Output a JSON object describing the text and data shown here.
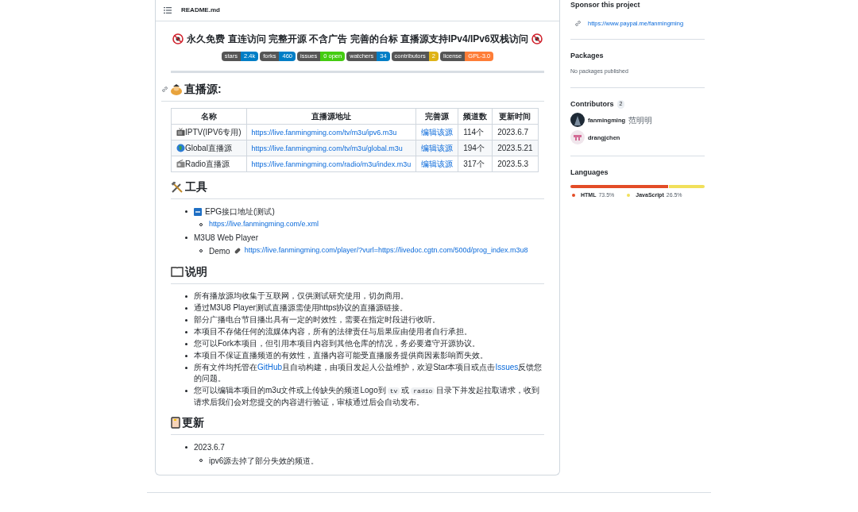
{
  "readme": {
    "file_name": "README.md",
    "tagline": "永久免费 直连访问 完整开源 不含广告 完善的台标 直播源支持IPv4/IPv6双栈访问",
    "badges": [
      {
        "label": "stars",
        "value": "2.4k",
        "color": "#007ec6"
      },
      {
        "label": "forks",
        "value": "460",
        "color": "#007ec6"
      },
      {
        "label": "issues",
        "value": "0 open",
        "color": "#4c1"
      },
      {
        "label": "watchers",
        "value": "34",
        "color": "#007ec6"
      },
      {
        "label": "contributors",
        "value": "2",
        "color": "#dfb317"
      },
      {
        "label": "license",
        "value": "GPL-3.0",
        "color": "#fe7d37"
      }
    ],
    "sources": {
      "heading": "直播源:",
      "columns": [
        "名称",
        "直播源地址",
        "完善源",
        "频道数",
        "更新时间"
      ],
      "rows": [
        {
          "name": "IPTV(IPV6专用)",
          "url": "https://live.fanmingming.com/tv/m3u/ipv6.m3u",
          "edit": "编辑该源",
          "count": "114个",
          "updated": "2023.6.7"
        },
        {
          "name": "Global直播源",
          "url": "https://live.fanmingming.com/tv/m3u/global.m3u",
          "edit": "编辑该源",
          "count": "194个",
          "updated": "2023.5.21"
        },
        {
          "name": "Radio直播源",
          "url": "https://live.fanmingming.com/radio/m3u/index.m3u",
          "edit": "编辑该源",
          "count": "317个",
          "updated": "2023.5.3"
        }
      ]
    },
    "tools": {
      "heading": "工具",
      "items": [
        {
          "text": "EPG接口地址(测试)",
          "sub_link": "https://live.fanmingming.com/e.xml"
        },
        {
          "text": "M3U8 Web Player",
          "sub_prefix": "Demo",
          "sub_link": "https://live.fanmingming.com/player/?vurl=https://livedoc.cgtn.com/500d/prog_index.m3u8"
        }
      ]
    },
    "notes": {
      "heading": "说明",
      "items": [
        [
          {
            "kind": "text",
            "text": "所有播放源均收集于互联网，仅供测试研究使用，切勿商用。"
          }
        ],
        [
          {
            "kind": "text",
            "text": "通过M3U8 Player测试直播源需使用https协议的直播源链接。"
          }
        ],
        [
          {
            "kind": "text",
            "text": "部分广播电台节目播出具有一定的时效性，需要在指定时段进行收听。"
          }
        ],
        [
          {
            "kind": "text",
            "text": "本项目不存储任何的流媒体内容，所有的法律责任与后果应由使用者自行承担。"
          }
        ],
        [
          {
            "kind": "text",
            "text": "您可以Fork本项目，但引用本项目内容到其他仓库的情况，务必要遵守开源协议。"
          }
        ],
        [
          {
            "kind": "text",
            "text": "本项目不保证直播频道的有效性，直播内容可能受直播服务提供商因素影响而失效。"
          }
        ],
        [
          {
            "kind": "text",
            "text": "所有文件均托管在"
          },
          {
            "kind": "link",
            "text": "GitHub"
          },
          {
            "kind": "text",
            "text": "且自动构建，由项目发起人公益维护，欢迎Star本项目或点击"
          },
          {
            "kind": "link",
            "text": "Issues"
          },
          {
            "kind": "text",
            "text": "反馈您的问题。"
          }
        ],
        [
          {
            "kind": "text",
            "text": "您可以编辑本项目的m3u文件或上传缺失的频道Logo到"
          },
          {
            "kind": "code",
            "text": "tv"
          },
          {
            "kind": "text",
            "text": "或"
          },
          {
            "kind": "code",
            "text": "radio"
          },
          {
            "kind": "text",
            "text": "目录下并发起拉取请求，收到请求后我们会对您提交的内容进行验证，审核通过后会自动发布。"
          }
        ]
      ]
    },
    "updates": {
      "heading": "更新",
      "items": [
        {
          "date": "2023.6.7",
          "changes": [
            "ipv6源去掉了部分失效的频道。"
          ]
        }
      ]
    }
  },
  "sidebar": {
    "sponsor": {
      "title": "Sponsor this project",
      "link": "https://www.paypal.me/fanmingming"
    },
    "packages": {
      "title": "Packages",
      "empty": "No packages published"
    },
    "contributors": {
      "title": "Contributors",
      "count": "2",
      "people": [
        {
          "login": "fanmingming",
          "name": "范明明"
        },
        {
          "login": "drangjchen"
        }
      ]
    },
    "languages": {
      "title": "Languages",
      "items": [
        {
          "name": "HTML",
          "percent": "73.5%",
          "level": 0.735,
          "color": "#e34c26"
        },
        {
          "name": "JavaScript",
          "percent": "26.5%",
          "level": 0.265,
          "color": "#f1e05a"
        }
      ]
    }
  }
}
